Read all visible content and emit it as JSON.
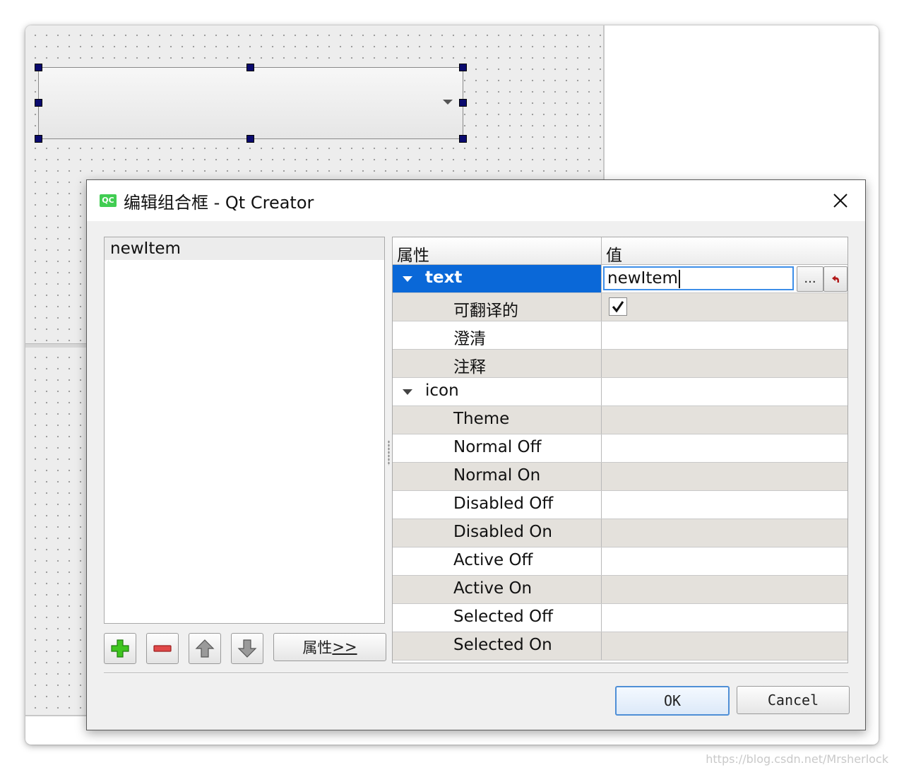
{
  "dialog": {
    "title": "编辑组合框 - Qt Creator",
    "logo_text": "QC"
  },
  "items": [
    "newItem"
  ],
  "toolbar": {
    "properties_prefix": "属性",
    "properties_suffix": ">>"
  },
  "property_table": {
    "headers": {
      "property": "属性",
      "value": "值"
    },
    "rows": [
      {
        "name": "text",
        "value": "newItem"
      },
      {
        "name": "可翻译的",
        "value": ""
      },
      {
        "name": "澄清",
        "value": ""
      },
      {
        "name": "注释",
        "value": ""
      },
      {
        "name": "icon",
        "value": ""
      },
      {
        "name": "Theme",
        "value": ""
      },
      {
        "name": "Normal Off",
        "value": ""
      },
      {
        "name": "Normal On",
        "value": ""
      },
      {
        "name": "Disabled Off",
        "value": ""
      },
      {
        "name": "Disabled On",
        "value": ""
      },
      {
        "name": "Active Off",
        "value": ""
      },
      {
        "name": "Active On",
        "value": ""
      },
      {
        "name": "Selected Off",
        "value": ""
      },
      {
        "name": "Selected On",
        "value": ""
      }
    ],
    "ellipsis_label": "...",
    "translatable_checked": true
  },
  "buttons": {
    "ok": "OK",
    "cancel": "Cancel"
  },
  "watermark": "https://blog.csdn.net/Mrsherlock",
  "colors": {
    "selection": "#0a68d8",
    "shaded_row": "#e4e1dc",
    "qt_green": "#41cd52"
  }
}
